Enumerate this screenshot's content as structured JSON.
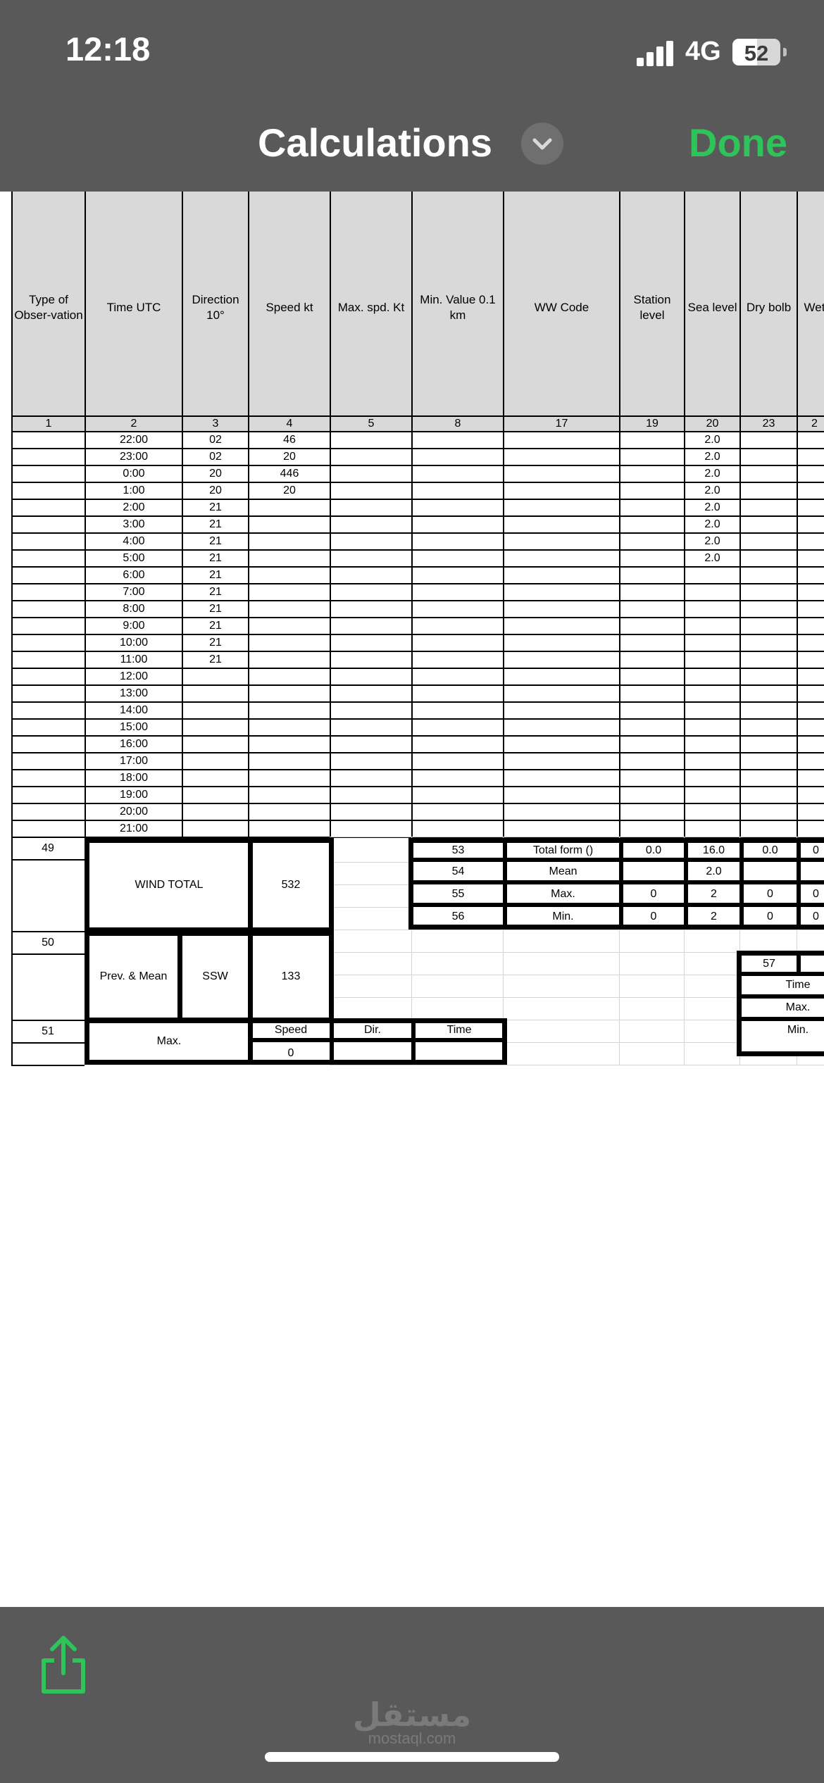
{
  "status_bar": {
    "time": "12:18",
    "network": "4G",
    "battery": "52",
    "battery_level": 0.52
  },
  "nav": {
    "title": "Calculations",
    "done_label": "Done"
  },
  "sheet": {
    "headers": [
      "Type of\nObser-vation",
      "Time UTC",
      "Direction\n10°",
      "Speed kt",
      "Max. spd. Kt",
      "Min. Value 0.1\nkm",
      "WW Code",
      "Station\nlevel",
      "Sea level",
      "Dry bolb",
      "Wet"
    ],
    "column_numbers": [
      "1",
      "2",
      "3",
      "4",
      "5",
      "8",
      "17",
      "19",
      "20",
      "23",
      "2"
    ],
    "rows": [
      [
        "",
        "22:00",
        "02",
        "46",
        "",
        "",
        "",
        "",
        "2.0",
        "",
        ""
      ],
      [
        "",
        "23:00",
        "02",
        "20",
        "",
        "",
        "",
        "",
        "2.0",
        "",
        ""
      ],
      [
        "",
        "0:00",
        "20",
        "446",
        "",
        "",
        "",
        "",
        "2.0",
        "",
        ""
      ],
      [
        "",
        "1:00",
        "20",
        "20",
        "",
        "",
        "",
        "",
        "2.0",
        "",
        ""
      ],
      [
        "",
        "2:00",
        "21",
        "",
        "",
        "",
        "",
        "",
        "2.0",
        "",
        ""
      ],
      [
        "",
        "3:00",
        "21",
        "",
        "",
        "",
        "",
        "",
        "2.0",
        "",
        ""
      ],
      [
        "",
        "4:00",
        "21",
        "",
        "",
        "",
        "",
        "",
        "2.0",
        "",
        ""
      ],
      [
        "",
        "5:00",
        "21",
        "",
        "",
        "",
        "",
        "",
        "2.0",
        "",
        ""
      ],
      [
        "",
        "6:00",
        "21",
        "",
        "",
        "",
        "",
        "",
        "",
        "",
        ""
      ],
      [
        "",
        "7:00",
        "21",
        "",
        "",
        "",
        "",
        "",
        "",
        "",
        ""
      ],
      [
        "",
        "8:00",
        "21",
        "",
        "",
        "",
        "",
        "",
        "",
        "",
        ""
      ],
      [
        "",
        "9:00",
        "21",
        "",
        "",
        "",
        "",
        "",
        "",
        "",
        ""
      ],
      [
        "",
        "10:00",
        "21",
        "",
        "",
        "",
        "",
        "",
        "",
        "",
        ""
      ],
      [
        "",
        "11:00",
        "21",
        "",
        "",
        "",
        "",
        "",
        "",
        "",
        ""
      ],
      [
        "",
        "12:00",
        "",
        "",
        "",
        "",
        "",
        "",
        "",
        "",
        ""
      ],
      [
        "",
        "13:00",
        "",
        "",
        "",
        "",
        "",
        "",
        "",
        "",
        ""
      ],
      [
        "",
        "14:00",
        "",
        "",
        "",
        "",
        "",
        "",
        "",
        "",
        ""
      ],
      [
        "",
        "15:00",
        "",
        "",
        "",
        "",
        "",
        "",
        "",
        "",
        ""
      ],
      [
        "",
        "16:00",
        "",
        "",
        "",
        "",
        "",
        "",
        "",
        "",
        ""
      ],
      [
        "",
        "17:00",
        "",
        "",
        "",
        "",
        "",
        "",
        "",
        "",
        ""
      ],
      [
        "",
        "18:00",
        "",
        "",
        "",
        "",
        "",
        "",
        "",
        "",
        ""
      ],
      [
        "",
        "19:00",
        "",
        "",
        "",
        "",
        "",
        "",
        "",
        "",
        ""
      ],
      [
        "",
        "20:00",
        "",
        "",
        "",
        "",
        "",
        "",
        "",
        "",
        ""
      ],
      [
        "",
        "21:00",
        "",
        "",
        "",
        "",
        "",
        "",
        "",
        "",
        ""
      ]
    ],
    "row_labels": {
      "r49": "49",
      "r50": "50",
      "r51": "51"
    },
    "wind_total": {
      "label": "WIND TOTAL",
      "value": "532"
    },
    "prev_mean": {
      "label": "Prev. & Mean",
      "direction": "SSW",
      "value": "133"
    },
    "max_block": {
      "label": "Max.",
      "speed_label": "Speed",
      "dir_label": "Dir.",
      "time_label": "Time",
      "speed_value": "0",
      "dir_value": "",
      "time_value": ""
    },
    "stats": [
      {
        "num": "53",
        "label": "Total form ()",
        "station": "0.0",
        "sea": "16.0",
        "dry": "0.0",
        "wet": "0"
      },
      {
        "num": "54",
        "label": "Mean",
        "station": "",
        "sea": "2.0",
        "dry": "",
        "wet": ""
      },
      {
        "num": "55",
        "label": "Max.",
        "station": "0",
        "sea": "2",
        "dry": "0",
        "wet": "0"
      },
      {
        "num": "56",
        "label": "Min.",
        "station": "0",
        "sea": "2",
        "dry": "0",
        "wet": "0"
      }
    ],
    "block57": {
      "num": "57",
      "time": "Time",
      "max": "Max.",
      "min": "Min."
    }
  },
  "watermark": {
    "arabic": "مستقل",
    "latin": "mostaql.com"
  },
  "icons": [
    "share-icon",
    "chevron-down-icon",
    "signal-icon",
    "battery-icon"
  ]
}
